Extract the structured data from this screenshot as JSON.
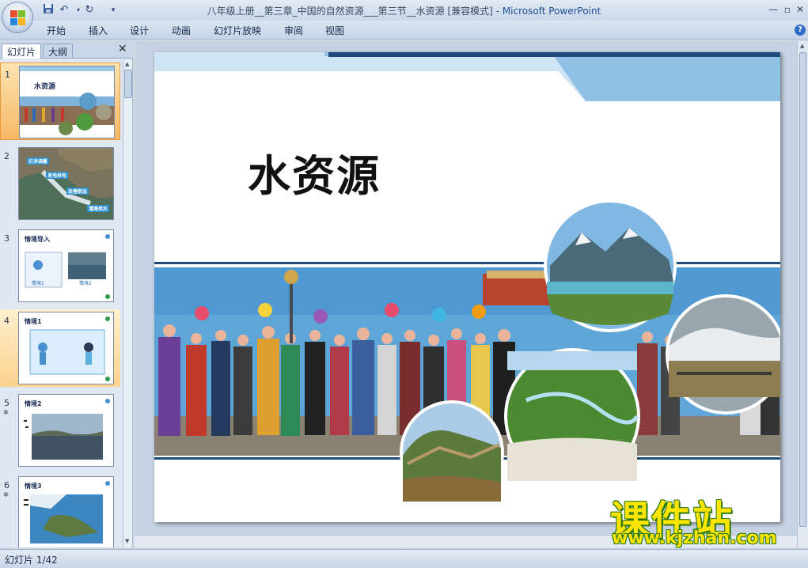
{
  "window": {
    "title": "八年级上册__第三章_中国的自然资源___第三节__水资源 [兼容模式] - ",
    "app_name": "Microsoft PowerPoint"
  },
  "ribbon": {
    "tabs": [
      "开始",
      "插入",
      "设计",
      "动画",
      "幻灯片放映",
      "审阅",
      "视图"
    ]
  },
  "left_pane": {
    "tabs": [
      "幻灯片",
      "大纲"
    ],
    "active_tab": "幻灯片",
    "thumbnails": [
      {
        "number": "1",
        "title": "水资源",
        "selected": true
      },
      {
        "number": "2",
        "labels": [
          "拦洪调蓄",
          "发电供电",
          "改善航运",
          "灌溉供水"
        ]
      },
      {
        "number": "3",
        "title": "情境导入",
        "captions": [
          "情境1",
          "情境2"
        ]
      },
      {
        "number": "4",
        "title": "情境1",
        "selected_hover": true
      },
      {
        "number": "5",
        "title": "情境2"
      },
      {
        "number": "6",
        "title": "情境3"
      }
    ]
  },
  "slide": {
    "title": "水资源"
  },
  "watermark": {
    "brand": "课件站",
    "url": "www.kjzhan.com"
  },
  "status": {
    "slide_counter": "幻灯片 1/42"
  },
  "colors": {
    "accent_blue": "#1f4e91",
    "slide_band": "#8fc1e6",
    "selection": "#f7b867",
    "watermark_yellow": "#ffe400"
  }
}
